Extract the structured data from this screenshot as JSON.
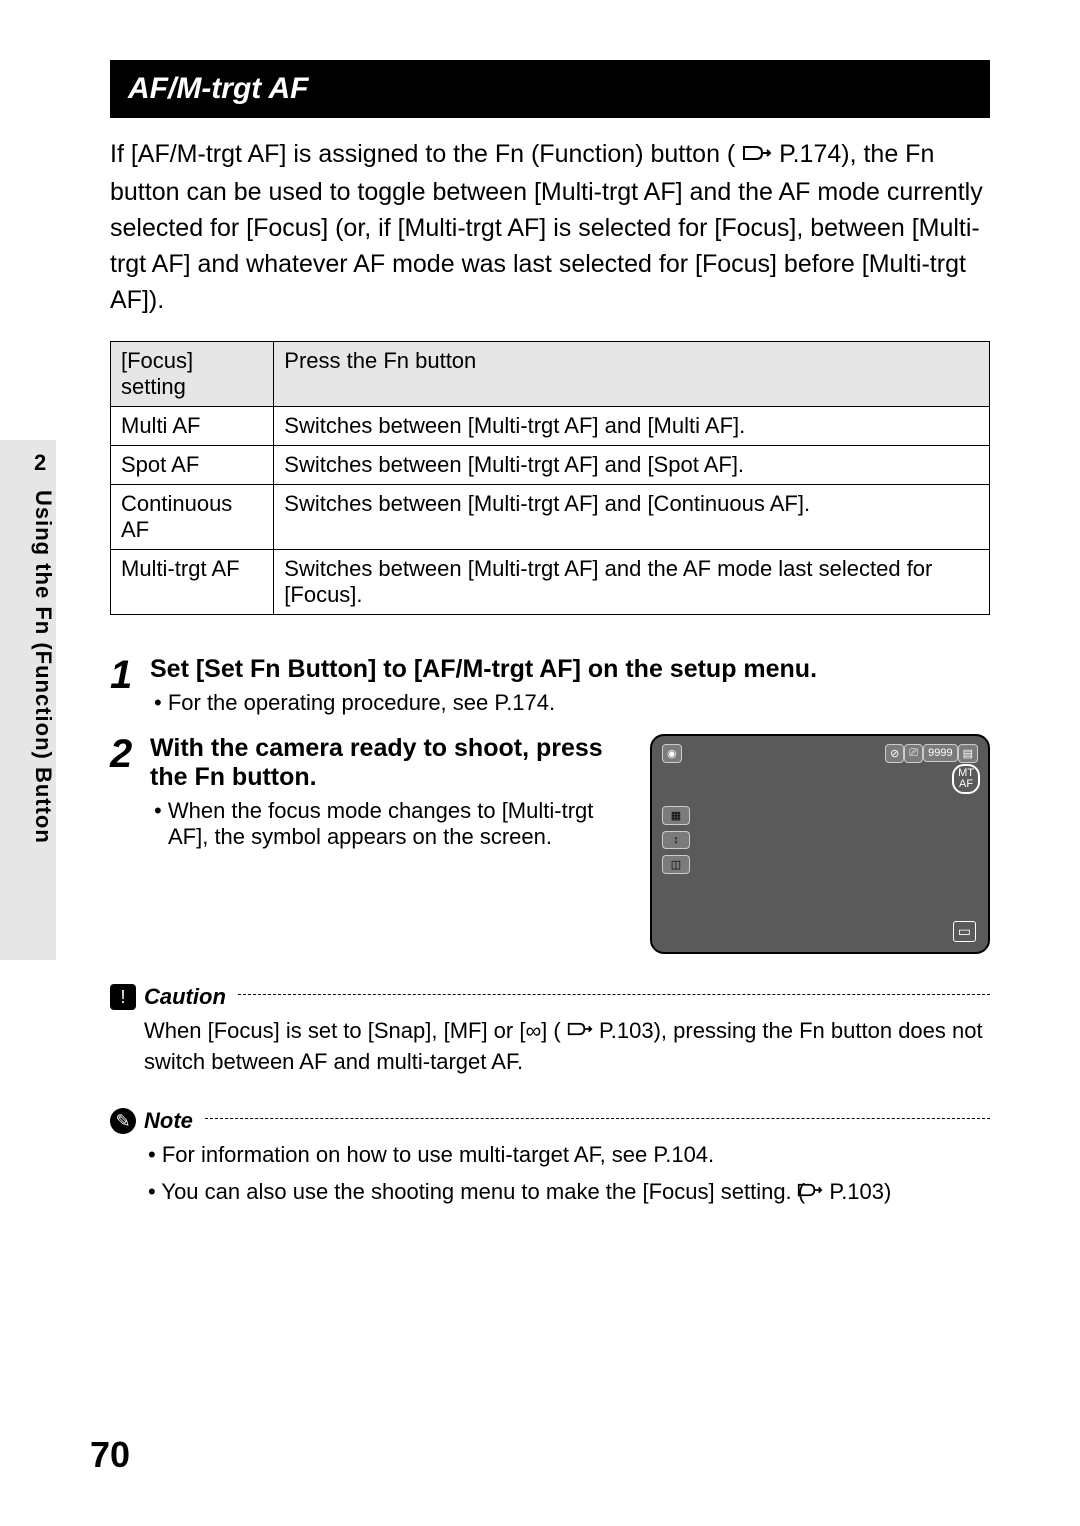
{
  "sidebar": {
    "chapter_number": "2",
    "chapter_title": "Using the Fn (Function) Button"
  },
  "page_number": "70",
  "section_title": "AF/M-trgt AF",
  "intro_text_1": "If [AF/M-trgt AF] is assigned to the Fn (Function) button (",
  "intro_ref": "P.174",
  "intro_text_2": "), the Fn button can be used to toggle between [Multi-trgt AF] and the AF mode currently selected for [Focus] (or, if [Multi-trgt AF] is selected for [Focus], between [Multi-trgt AF] and whatever AF mode was last selected for [Focus] before [Multi-trgt AF]).",
  "table": {
    "headers": [
      "[Focus] setting",
      "Press the Fn button"
    ],
    "rows": [
      [
        "Multi AF",
        "Switches between [Multi-trgt AF] and [Multi AF]."
      ],
      [
        "Spot AF",
        "Switches between [Multi-trgt AF] and [Spot AF]."
      ],
      [
        "Continuous AF",
        "Switches between [Multi-trgt AF] and [Continuous AF]."
      ],
      [
        "Multi-trgt AF",
        "Switches between [Multi-trgt AF] and the AF mode last selected for [Focus]."
      ]
    ]
  },
  "steps": [
    {
      "num": "1",
      "title": "Set [Set Fn Button] to [AF/M-trgt AF] on the setup menu.",
      "bullets": [
        "For the operating procedure, see P.174."
      ]
    },
    {
      "num": "2",
      "title": "With the camera ready to shoot, press the Fn button.",
      "bullets": [
        "When the focus mode changes to [Multi-trgt AF], the symbol appears on the screen."
      ]
    }
  ],
  "camera": {
    "count": "9999",
    "mt_label": "MT\nAF"
  },
  "caution": {
    "label": "Caution",
    "text_1": "When [Focus] is set to [Snap], [MF] or [∞] (",
    "ref": "P.103",
    "text_2": "), pressing the Fn button does not switch between AF and multi-target AF."
  },
  "note": {
    "label": "Note",
    "bullets_1": "For information on how to use multi-target AF, see P.104.",
    "bullets_2a": "You can also use the shooting menu to make the [Focus] setting. (",
    "bullets_2_ref": "P.103",
    "bullets_2b": ")"
  }
}
